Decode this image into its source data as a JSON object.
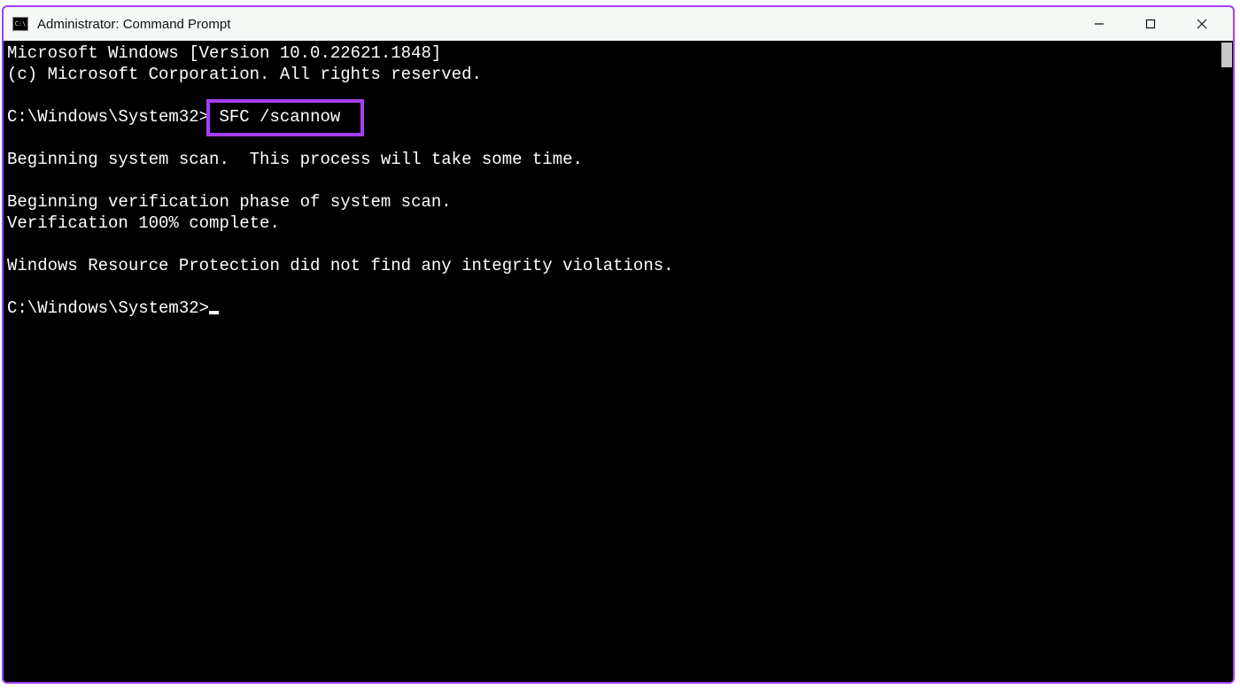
{
  "window": {
    "title": "Administrator: Command Prompt"
  },
  "terminal": {
    "line_version": "Microsoft Windows [Version 10.0.22621.1848]",
    "line_copyright": "(c) Microsoft Corporation. All rights reserved.",
    "blank1": "",
    "prompt1_prefix": "C:\\Windows\\System32>",
    "prompt1_command": "SFC /scannow",
    "blank2": "",
    "line_begin_scan": "Beginning system scan.  This process will take some time.",
    "blank3": "",
    "line_verify_phase": "Beginning verification phase of system scan.",
    "line_verify_complete": "Verification 100% complete.",
    "blank4": "",
    "line_result": "Windows Resource Protection did not find any integrity violations.",
    "blank5": "",
    "prompt2_prefix": "C:\\Windows\\System32>"
  },
  "highlight": {
    "color": "#a63ef5"
  }
}
